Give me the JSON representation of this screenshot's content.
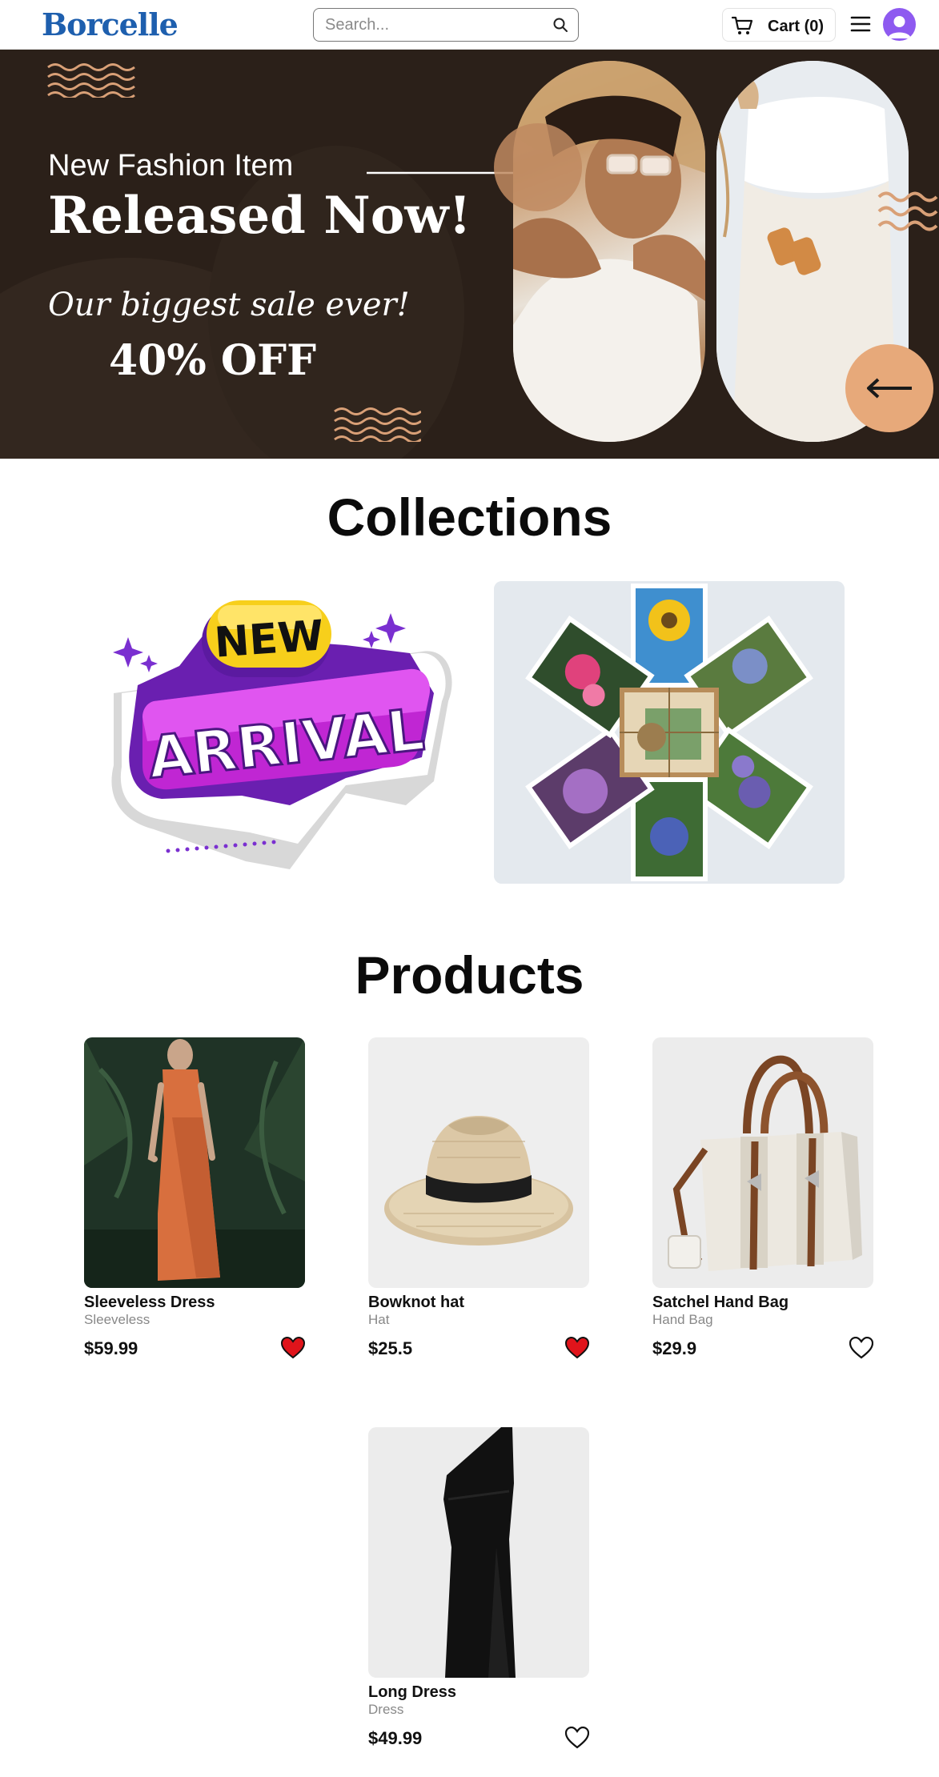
{
  "header": {
    "logo": "Borcelle",
    "search_placeholder": "Search...",
    "cart_label": "Cart (0)"
  },
  "hero": {
    "kicker": "New Fashion Item",
    "title": "Released Now!",
    "tagline": "Our biggest sale ever!",
    "discount": "40% OFF",
    "background_color": "#2b2019",
    "accent_color": "#e7a97a"
  },
  "collections": {
    "title": "Collections",
    "promo": {
      "badge_top": "NEW",
      "badge_main": "ARRIVAL"
    }
  },
  "products": {
    "title": "Products",
    "items": [
      {
        "name": "Sleeveless Dress",
        "category": "Sleeveless",
        "price": "$59.99",
        "favorited": true,
        "icon": "heart-filled-icon"
      },
      {
        "name": "Bowknot hat",
        "category": "Hat",
        "price": "$25.5",
        "favorited": true,
        "icon": "heart-filled-icon"
      },
      {
        "name": "Satchel Hand Bag",
        "category": "Hand Bag",
        "price": "$29.9",
        "favorited": false,
        "icon": "heart-outline-icon"
      },
      {
        "name": "Long Dress",
        "category": "Dress",
        "price": "$49.99",
        "favorited": false,
        "icon": "heart-outline-icon"
      }
    ]
  },
  "colors": {
    "brand": "#1e5fae",
    "favorite": "#e0141b",
    "avatar": "#8e5af0"
  }
}
